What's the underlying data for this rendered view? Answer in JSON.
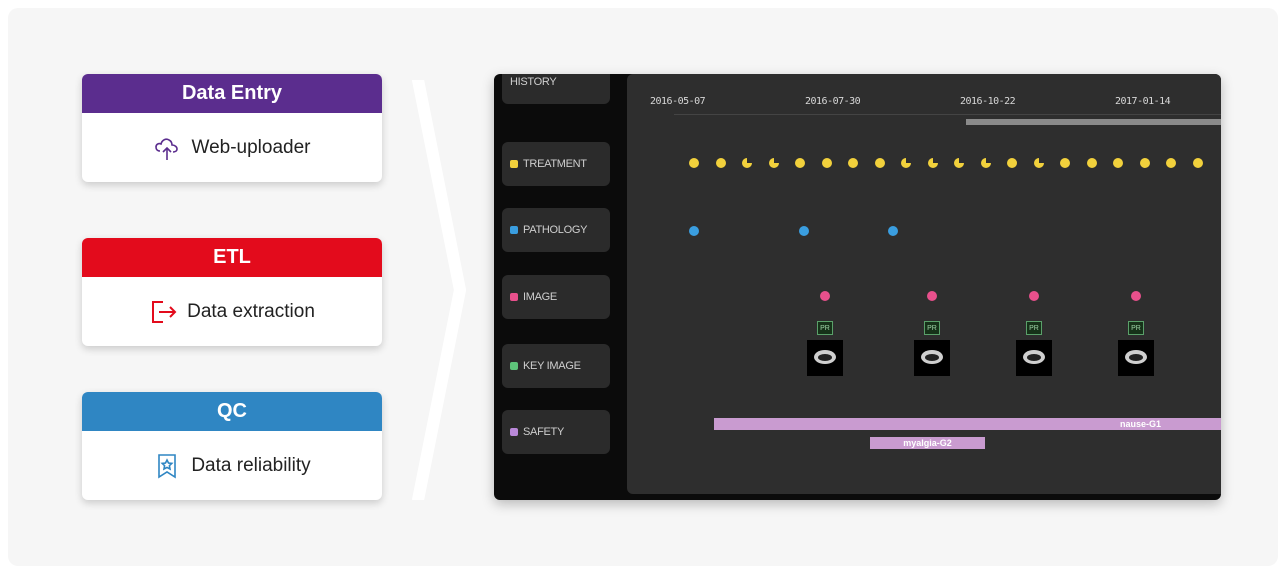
{
  "steps": [
    {
      "title": "Data Entry",
      "label": "Web-uploader",
      "icon": "cloud-upload-icon",
      "color": "#5b2d8e"
    },
    {
      "title": "ETL",
      "label": "Data extraction",
      "icon": "exit-arrow-icon",
      "color": "#e30b1c"
    },
    {
      "title": "QC",
      "label": "Data reliability",
      "icon": "badge-star-icon",
      "color": "#2f86c3"
    }
  ],
  "timeline": {
    "lanes": [
      {
        "label": "HISTORY",
        "color": ""
      },
      {
        "label": "TREATMENT",
        "color": "#f2d13c"
      },
      {
        "label": "PATHOLOGY",
        "color": "#3a9ee0"
      },
      {
        "label": "IMAGE",
        "color": "#e8508c"
      },
      {
        "label": "KEY IMAGE",
        "color": "#5ec47a"
      },
      {
        "label": "SAFETY",
        "color": "#b988d8"
      }
    ],
    "dates": [
      "2016-05-07",
      "2016-07-30",
      "2016-10-22",
      "2017-01-14"
    ],
    "key_image_tag": "PR",
    "events": {
      "safety": [
        "nause-G1",
        "myalgia-G2"
      ]
    }
  }
}
